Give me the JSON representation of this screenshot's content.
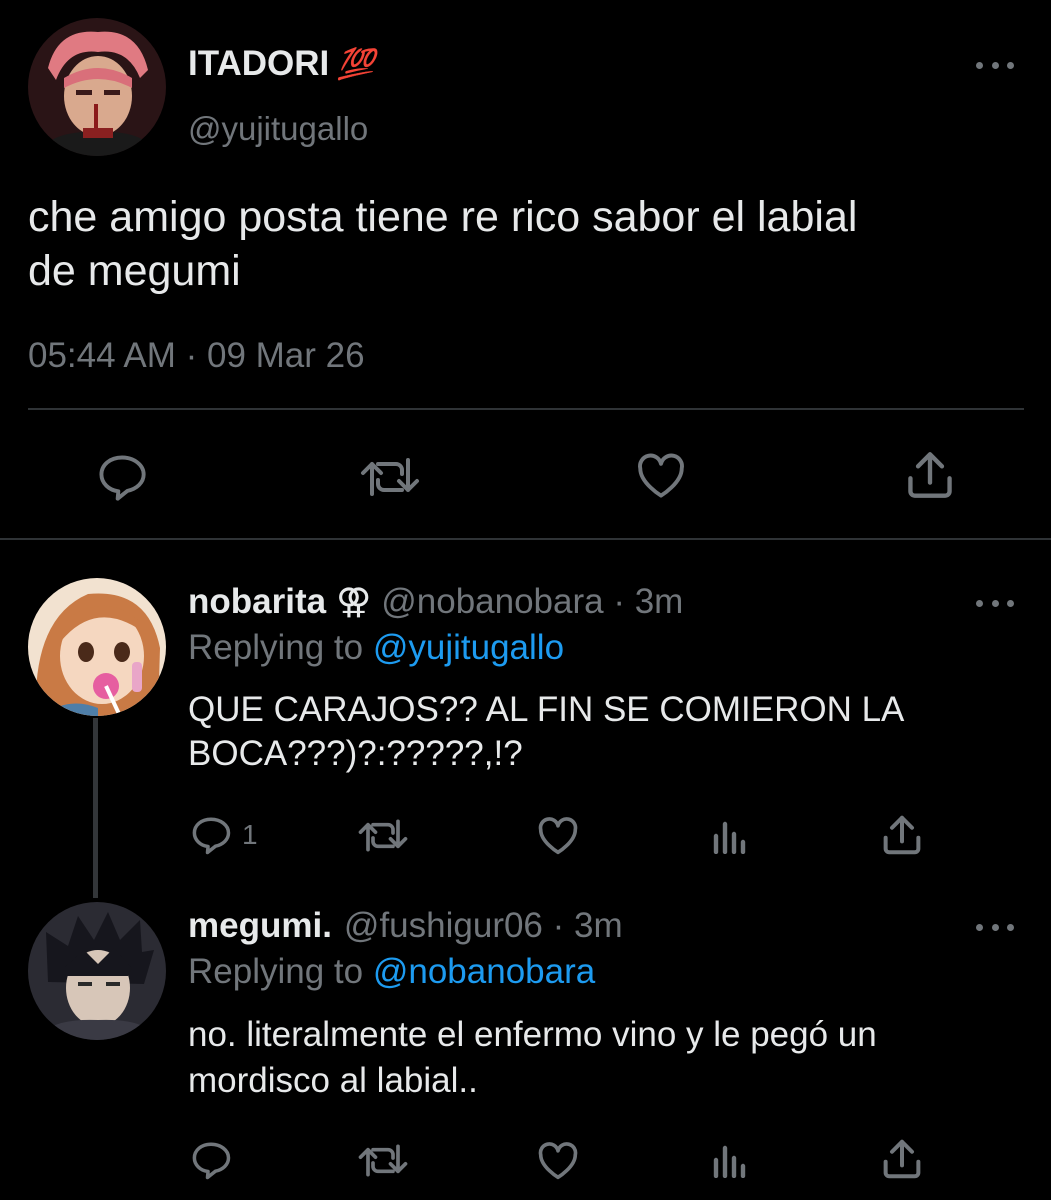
{
  "main_tweet": {
    "display_name": "ITADORI",
    "name_emoji": "💯",
    "handle": "@yujitugallo",
    "text_line1": "che amigo posta tiene re rico sabor el labial",
    "text_line2": "de megumi",
    "timestamp": "05:44 AM · 09 Mar 26"
  },
  "replies": [
    {
      "display_name": "nobarita",
      "name_emoji": "⚢",
      "meta": "@nobanobara · 3m",
      "replying_prefix": "Replying to",
      "replying_to": "@yujitugallo",
      "text_line1": "QUE CARAJOS?? AL FIN SE COMIERON LA",
      "text_line2": "BOCA???)?:?????,!?",
      "reply_count": "1"
    },
    {
      "display_name": "megumi.",
      "meta": "@fushigur06 · 3m",
      "replying_prefix": "Replying to",
      "replying_to": "@nobanobara",
      "text_line1": "no. literalmente el enfermo vino y le pegó un",
      "text_line2": "mordisco al labial..",
      "reply_count": ""
    }
  ],
  "icons": [
    "more-icon",
    "reply-icon",
    "retweet-icon",
    "like-icon",
    "analytics-icon",
    "share-icon"
  ],
  "colors": {
    "background": "#000000",
    "text": "#e7e9ea",
    "muted": "#71767b",
    "link": "#1d9bf0",
    "divider": "#2f3336"
  }
}
